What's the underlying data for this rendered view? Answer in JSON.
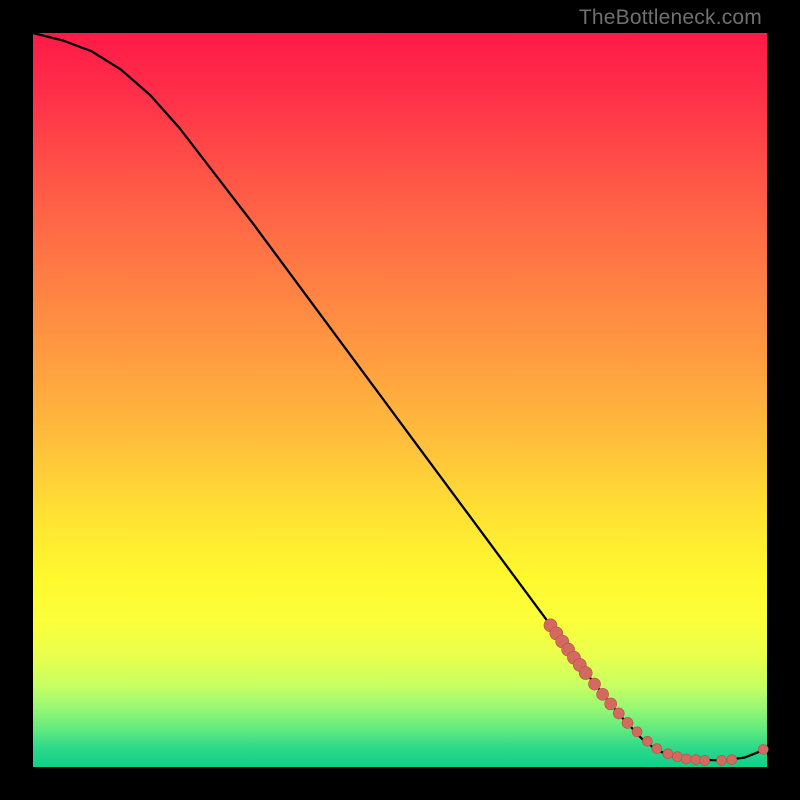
{
  "watermark": "TheBottleneck.com",
  "colors": {
    "curve": "#000000",
    "point_fill": "#d46a5f",
    "point_stroke": "#b64f45"
  },
  "chart_data": {
    "type": "line",
    "title": "",
    "xlabel": "",
    "ylabel": "",
    "xlim": [
      0,
      100
    ],
    "ylim": [
      0,
      100
    ],
    "grid": false,
    "curve": [
      {
        "x": 0,
        "y": 100
      },
      {
        "x": 4,
        "y": 99
      },
      {
        "x": 8,
        "y": 97.5
      },
      {
        "x": 12,
        "y": 95
      },
      {
        "x": 16,
        "y": 91.5
      },
      {
        "x": 20,
        "y": 87
      },
      {
        "x": 30,
        "y": 74
      },
      {
        "x": 40,
        "y": 60.5
      },
      {
        "x": 50,
        "y": 47
      },
      {
        "x": 60,
        "y": 33.5
      },
      {
        "x": 70,
        "y": 20
      },
      {
        "x": 76,
        "y": 12
      },
      {
        "x": 80,
        "y": 7
      },
      {
        "x": 83,
        "y": 3.8
      },
      {
        "x": 85,
        "y": 2.3
      },
      {
        "x": 87,
        "y": 1.5
      },
      {
        "x": 90,
        "y": 1.0
      },
      {
        "x": 94,
        "y": 0.9
      },
      {
        "x": 97,
        "y": 1.3
      },
      {
        "x": 100,
        "y": 2.5
      }
    ],
    "points": [
      {
        "x": 70.5,
        "y": 19.3,
        "r": 6.5
      },
      {
        "x": 71.3,
        "y": 18.2,
        "r": 6.5
      },
      {
        "x": 72.1,
        "y": 17.1,
        "r": 6.5
      },
      {
        "x": 72.9,
        "y": 16.0,
        "r": 6.5
      },
      {
        "x": 73.7,
        "y": 14.9,
        "r": 6.5
      },
      {
        "x": 74.5,
        "y": 13.9,
        "r": 6.5
      },
      {
        "x": 75.3,
        "y": 12.8,
        "r": 6.5
      },
      {
        "x": 76.5,
        "y": 11.3,
        "r": 6.0
      },
      {
        "x": 77.6,
        "y": 9.9,
        "r": 6.0
      },
      {
        "x": 78.7,
        "y": 8.6,
        "r": 6.0
      },
      {
        "x": 79.8,
        "y": 7.3,
        "r": 5.5
      },
      {
        "x": 81.0,
        "y": 6.0,
        "r": 5.5
      },
      {
        "x": 82.3,
        "y": 4.8,
        "r": 5.0
      },
      {
        "x": 83.7,
        "y": 3.5,
        "r": 5.0
      },
      {
        "x": 85.0,
        "y": 2.5,
        "r": 5.0
      },
      {
        "x": 86.5,
        "y": 1.8,
        "r": 5.0
      },
      {
        "x": 87.8,
        "y": 1.4,
        "r": 5.0
      },
      {
        "x": 89.0,
        "y": 1.1,
        "r": 5.0
      },
      {
        "x": 90.3,
        "y": 1.0,
        "r": 5.0
      },
      {
        "x": 91.5,
        "y": 0.9,
        "r": 5.0
      },
      {
        "x": 93.8,
        "y": 0.9,
        "r": 5.0
      },
      {
        "x": 95.2,
        "y": 1.0,
        "r": 5.0
      },
      {
        "x": 99.5,
        "y": 2.4,
        "r": 5.0
      }
    ]
  }
}
